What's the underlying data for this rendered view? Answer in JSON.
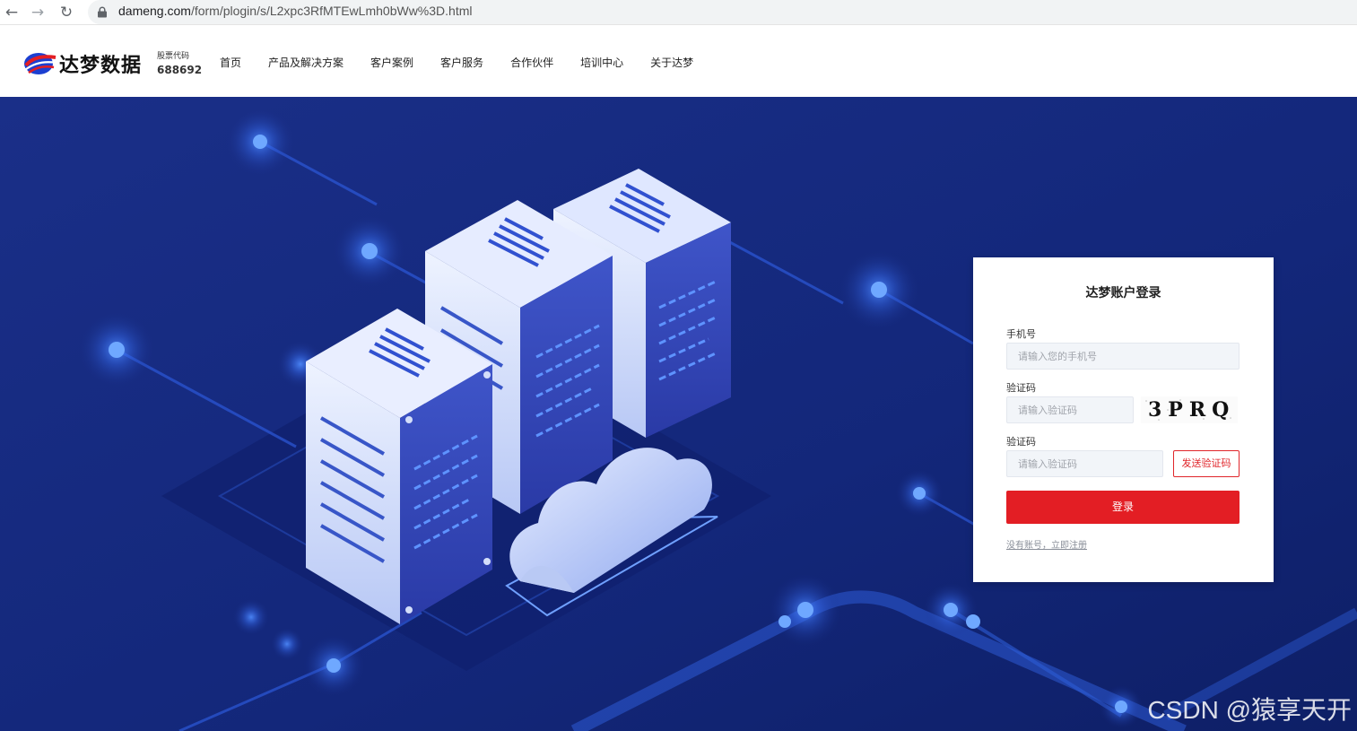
{
  "browser": {
    "url_domain": "dameng.com",
    "url_path": "/form/plogin/s/L2xpc3RfMTEwLmh0bWw%3D.html"
  },
  "header": {
    "logo_text": "达梦数据",
    "stock_label": "股票代码",
    "stock_code": "688692",
    "nav": [
      "首页",
      "产品及解决方案",
      "客户案例",
      "客户服务",
      "合作伙伴",
      "培训中心",
      "关于达梦"
    ]
  },
  "login": {
    "title": "达梦账户登录",
    "phone_label": "手机号",
    "phone_placeholder": "请输入您的手机号",
    "captcha_label": "验证码",
    "captcha_placeholder": "请输入验证码",
    "captcha_text": "3PRQ",
    "sms_label": "验证码",
    "sms_placeholder": "请输入验证码",
    "send_code": "发送验证码",
    "submit": "登录",
    "register": "没有账号，立即注册"
  },
  "watermark": "CSDN @猿享天开",
  "colors": {
    "primary_red": "#e31e24",
    "hero_bg": "#14297a",
    "brand_blue": "#1c3fd1"
  }
}
